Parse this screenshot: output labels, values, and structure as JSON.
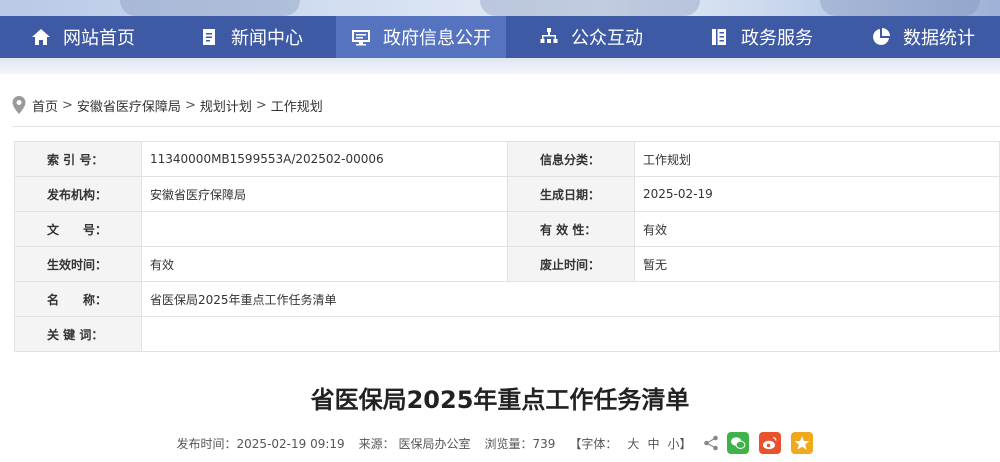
{
  "nav": {
    "items": [
      {
        "label": "网站首页",
        "icon": "home-icon"
      },
      {
        "label": "新闻中心",
        "icon": "document-icon"
      },
      {
        "label": "政府信息公开",
        "icon": "monitor-icon",
        "active": true
      },
      {
        "label": "公众互动",
        "icon": "network-icon"
      },
      {
        "label": "政务服务",
        "icon": "list-icon"
      },
      {
        "label": "数据统计",
        "icon": "pie-chart-icon"
      }
    ]
  },
  "breadcrumb": {
    "items": [
      "首页",
      "安徽省医疗保障局",
      "规划计划",
      "工作规划"
    ],
    "separator": ">"
  },
  "info": {
    "index_label": "索 引 号：",
    "index_value": "11340000MB1599553A/202502-00006",
    "category_label": "信息分类：",
    "category_value": "工作规划",
    "publisher_label": "发布机构：",
    "publisher_value": "安徽省医疗保障局",
    "date_label": "生成日期：",
    "date_value": "2025-02-19",
    "docno_label": "文　　号：",
    "docno_value": "",
    "validity_label": "有 效 性：",
    "validity_value": "有效",
    "effective_label": "生效时间：",
    "effective_value": "有效",
    "expire_label": "废止时间：",
    "expire_value": "暂无",
    "name_label": "名　　称：",
    "name_value": "省医保局2025年重点工作任务清单",
    "keywords_label": "关 键 词：",
    "keywords_value": ""
  },
  "article": {
    "title": "省医保局2025年重点工作任务清单",
    "publish_time": "发布时间：2025-02-19 09:19",
    "source": "来源： 医保局办公室",
    "views": "浏览量：739",
    "font_size_label": "【字体：",
    "font_large": "大",
    "font_medium": "中",
    "font_small": "小】"
  },
  "colors": {
    "nav_bg": "#3e5aa4",
    "nav_active": "#5673c0",
    "wechat": "#3fb34a",
    "weibo": "#e9522c",
    "favorite": "#f0a81d"
  }
}
